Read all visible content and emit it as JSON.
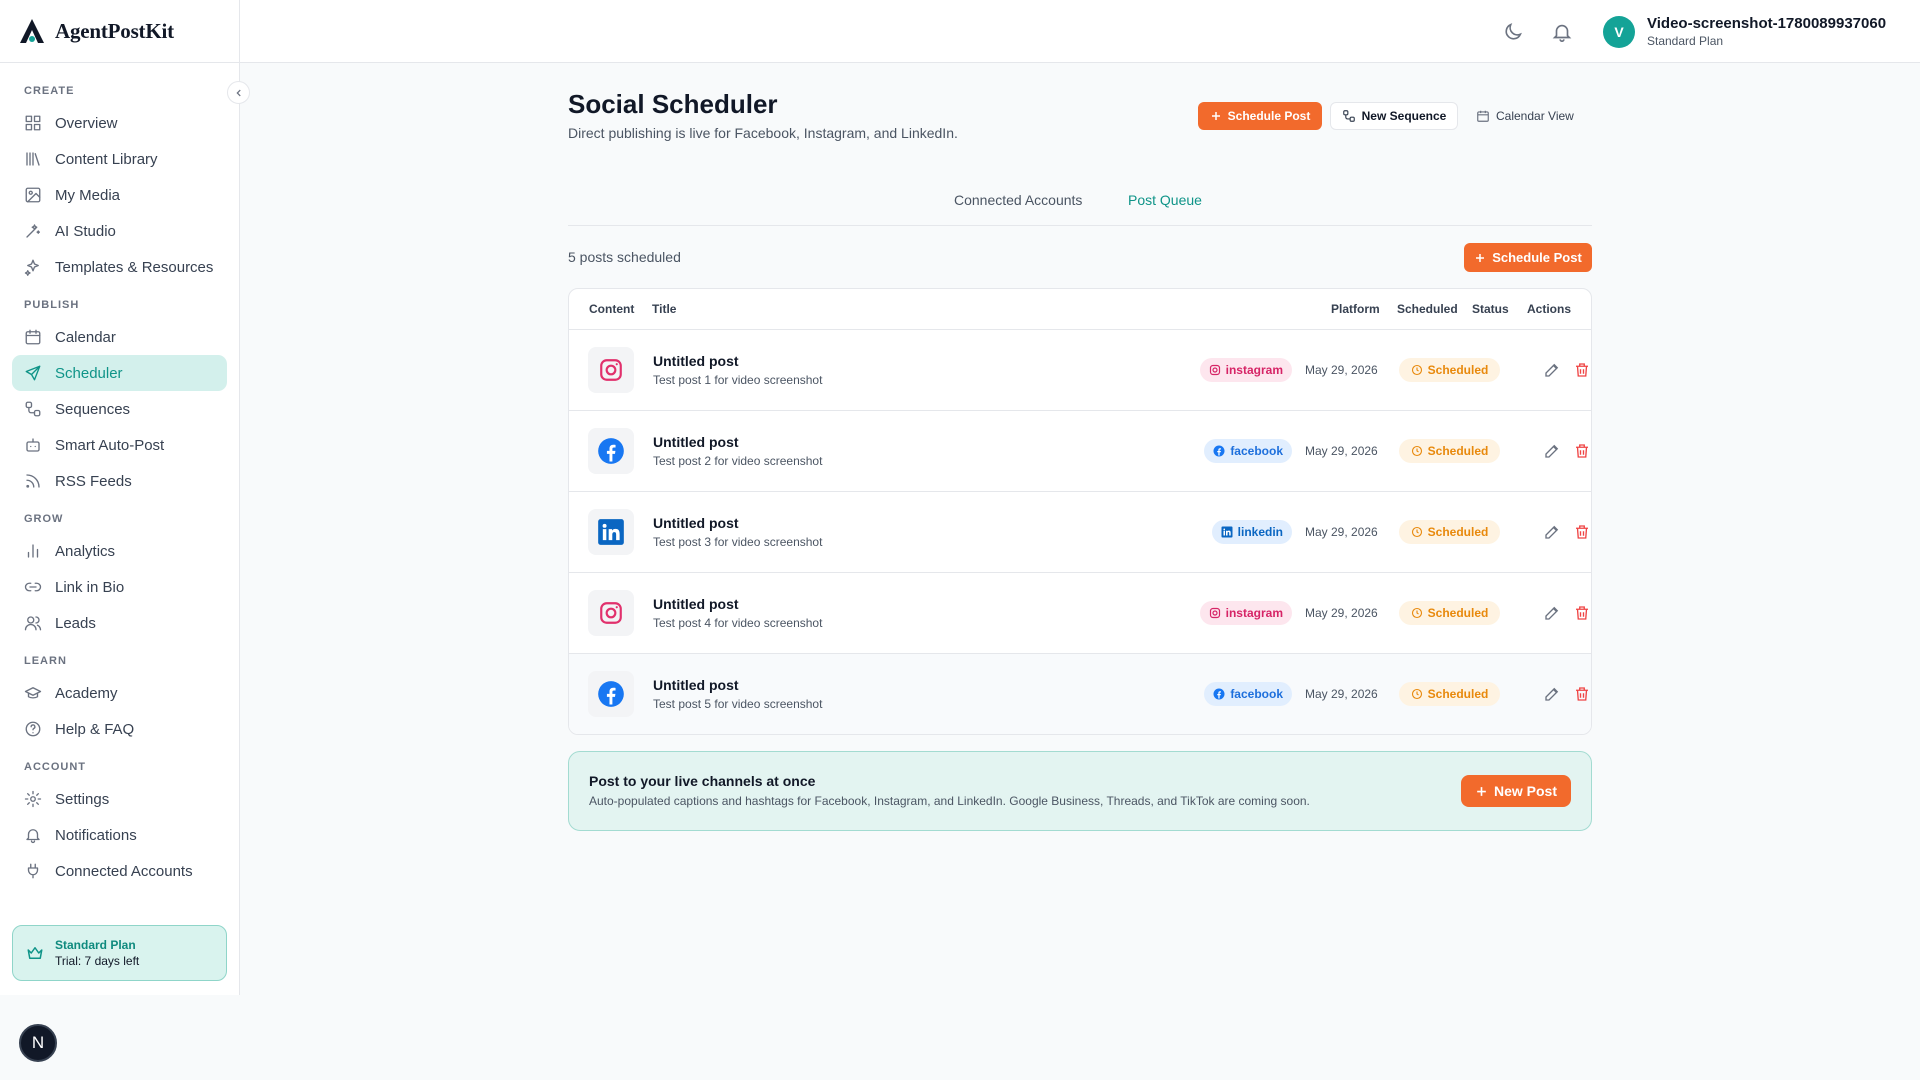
{
  "brand": {
    "name": "AgentPostKit"
  },
  "sidebar": {
    "sections": [
      {
        "label": "CREATE",
        "items": [
          {
            "label": "Overview",
            "icon": "grid-icon"
          },
          {
            "label": "Content Library",
            "icon": "library-icon"
          },
          {
            "label": "My Media",
            "icon": "image-icon"
          },
          {
            "label": "AI Studio",
            "icon": "wand-icon"
          },
          {
            "label": "Templates & Resources",
            "icon": "sparkles-icon"
          }
        ]
      },
      {
        "label": "PUBLISH",
        "items": [
          {
            "label": "Calendar",
            "icon": "calendar-icon"
          },
          {
            "label": "Scheduler",
            "icon": "send-icon",
            "active": true
          },
          {
            "label": "Sequences",
            "icon": "sequence-icon"
          },
          {
            "label": "Smart Auto-Post",
            "icon": "bot-icon"
          },
          {
            "label": "RSS Feeds",
            "icon": "rss-icon"
          }
        ]
      },
      {
        "label": "GROW",
        "items": [
          {
            "label": "Analytics",
            "icon": "bar-chart-icon"
          },
          {
            "label": "Link in Bio",
            "icon": "link-icon"
          },
          {
            "label": "Leads",
            "icon": "users-icon"
          }
        ]
      },
      {
        "label": "LEARN",
        "items": [
          {
            "label": "Academy",
            "icon": "graduation-cap-icon"
          },
          {
            "label": "Help & FAQ",
            "icon": "help-circle-icon"
          }
        ]
      },
      {
        "label": "ACCOUNT",
        "items": [
          {
            "label": "Settings",
            "icon": "gear-icon"
          },
          {
            "label": "Notifications",
            "icon": "bell-icon"
          },
          {
            "label": "Connected Accounts",
            "icon": "plug-icon"
          }
        ]
      }
    ],
    "plan_card": {
      "title": "Standard Plan",
      "subtitle": "Trial: 7 days left"
    }
  },
  "header": {
    "user_initial": "V",
    "user_name": "Video-screenshot-1780089937060",
    "user_plan": "Standard Plan"
  },
  "page": {
    "title": "Social Scheduler",
    "subtitle": "Direct publishing is live for Facebook, Instagram, and LinkedIn.",
    "schedule_post": "Schedule Post",
    "new_sequence": "New Sequence",
    "calendar_view": "Calendar View",
    "tabs": [
      "Connected Accounts",
      "Post Queue"
    ],
    "active_tab": "Post Queue"
  },
  "queue": {
    "count_text": "5 posts scheduled",
    "schedule_button": "Schedule Post",
    "columns": {
      "content": "Content",
      "title": "Title",
      "platform": "Platform",
      "scheduled": "Scheduled",
      "status": "Status",
      "actions": "Actions"
    },
    "rows": [
      {
        "title": "Untitled post",
        "subtitle": "Test post 1 for video screenshot",
        "platform": "instagram",
        "date": "May 29, 2026",
        "status": "Scheduled"
      },
      {
        "title": "Untitled post",
        "subtitle": "Test post 2 for video screenshot",
        "platform": "facebook",
        "date": "May 29, 2026",
        "status": "Scheduled"
      },
      {
        "title": "Untitled post",
        "subtitle": "Test post 3 for video screenshot",
        "platform": "linkedin",
        "date": "May 29, 2026",
        "status": "Scheduled"
      },
      {
        "title": "Untitled post",
        "subtitle": "Test post 4 for video screenshot",
        "platform": "instagram",
        "date": "May 29, 2026",
        "status": "Scheduled"
      },
      {
        "title": "Untitled post",
        "subtitle": "Test post 5 for video screenshot",
        "platform": "facebook",
        "date": "May 29, 2026",
        "status": "Scheduled"
      }
    ]
  },
  "promo": {
    "title": "Post to your live channels at once",
    "subtitle": "Auto-populated captions and hashtags for Facebook, Instagram, and LinkedIn. Google Business, Threads, and TikTok are coming soon.",
    "button": "New Post"
  },
  "dev_badge": "N",
  "colors": {
    "accent": "#0f9488",
    "brand_orange": "#f26a2c",
    "status_scheduled": "#e8890c"
  }
}
